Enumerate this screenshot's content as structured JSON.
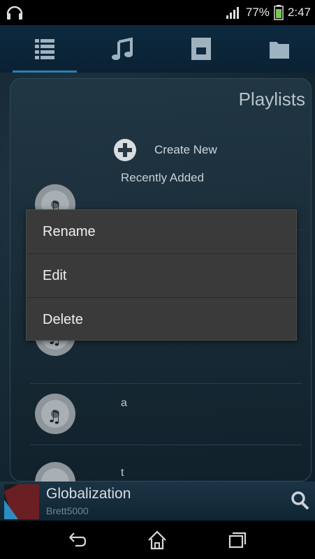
{
  "status": {
    "battery_percent": "77%",
    "time": "2:47"
  },
  "tabs": [
    {
      "icon": "list-icon",
      "active": true
    },
    {
      "icon": "music-note-icon",
      "active": false
    },
    {
      "icon": "album-icon",
      "active": false
    },
    {
      "icon": "folder-icon",
      "active": false
    }
  ],
  "panel": {
    "title": "Playlists",
    "create_label": "Create New",
    "recent_label": "Recently Added",
    "items": [
      {
        "name": ""
      },
      {
        "name": ""
      },
      {
        "name": "a"
      },
      {
        "name": "t"
      }
    ]
  },
  "context_menu": {
    "items": [
      "Rename",
      "Edit",
      "Delete"
    ]
  },
  "now_playing": {
    "title": "Globalization",
    "artist": "Brett5000"
  },
  "colors": {
    "accent": "#2d7fb0",
    "menu_bg": "#3a3a3a"
  }
}
